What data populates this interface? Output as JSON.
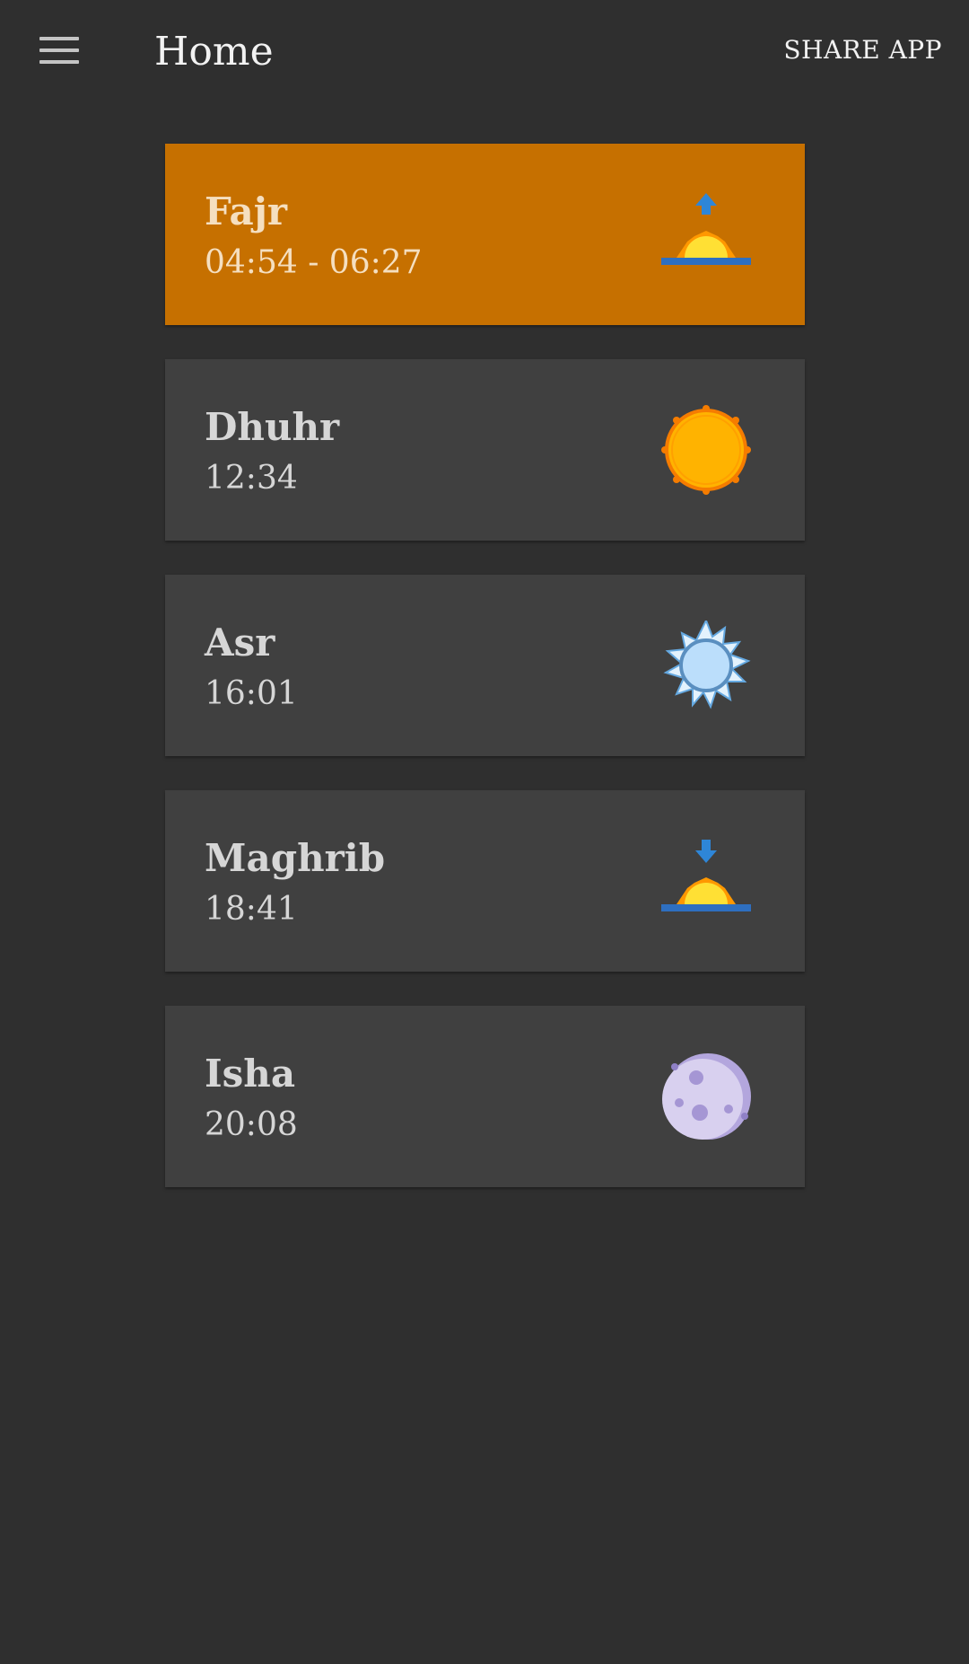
{
  "app_bar": {
    "menu_icon": "hamburger-menu-icon",
    "title": "Home",
    "share_label": "SHARE APP"
  },
  "colors": {
    "background": "#2f2f2f",
    "card": "#404040",
    "active_card": "#c67000",
    "text": "#d6d6d6"
  },
  "prayers": [
    {
      "name": "Fajr",
      "time": "04:54 - 06:27",
      "icon": "sunrise-icon",
      "active": true
    },
    {
      "name": "Dhuhr",
      "time": "12:34",
      "icon": "sun-icon",
      "active": false
    },
    {
      "name": "Asr",
      "time": "16:01",
      "icon": "afternoon-sun-icon",
      "active": false
    },
    {
      "name": "Maghrib",
      "time": "18:41",
      "icon": "sunset-icon",
      "active": false
    },
    {
      "name": "Isha",
      "time": "20:08",
      "icon": "moon-icon",
      "active": false
    }
  ]
}
